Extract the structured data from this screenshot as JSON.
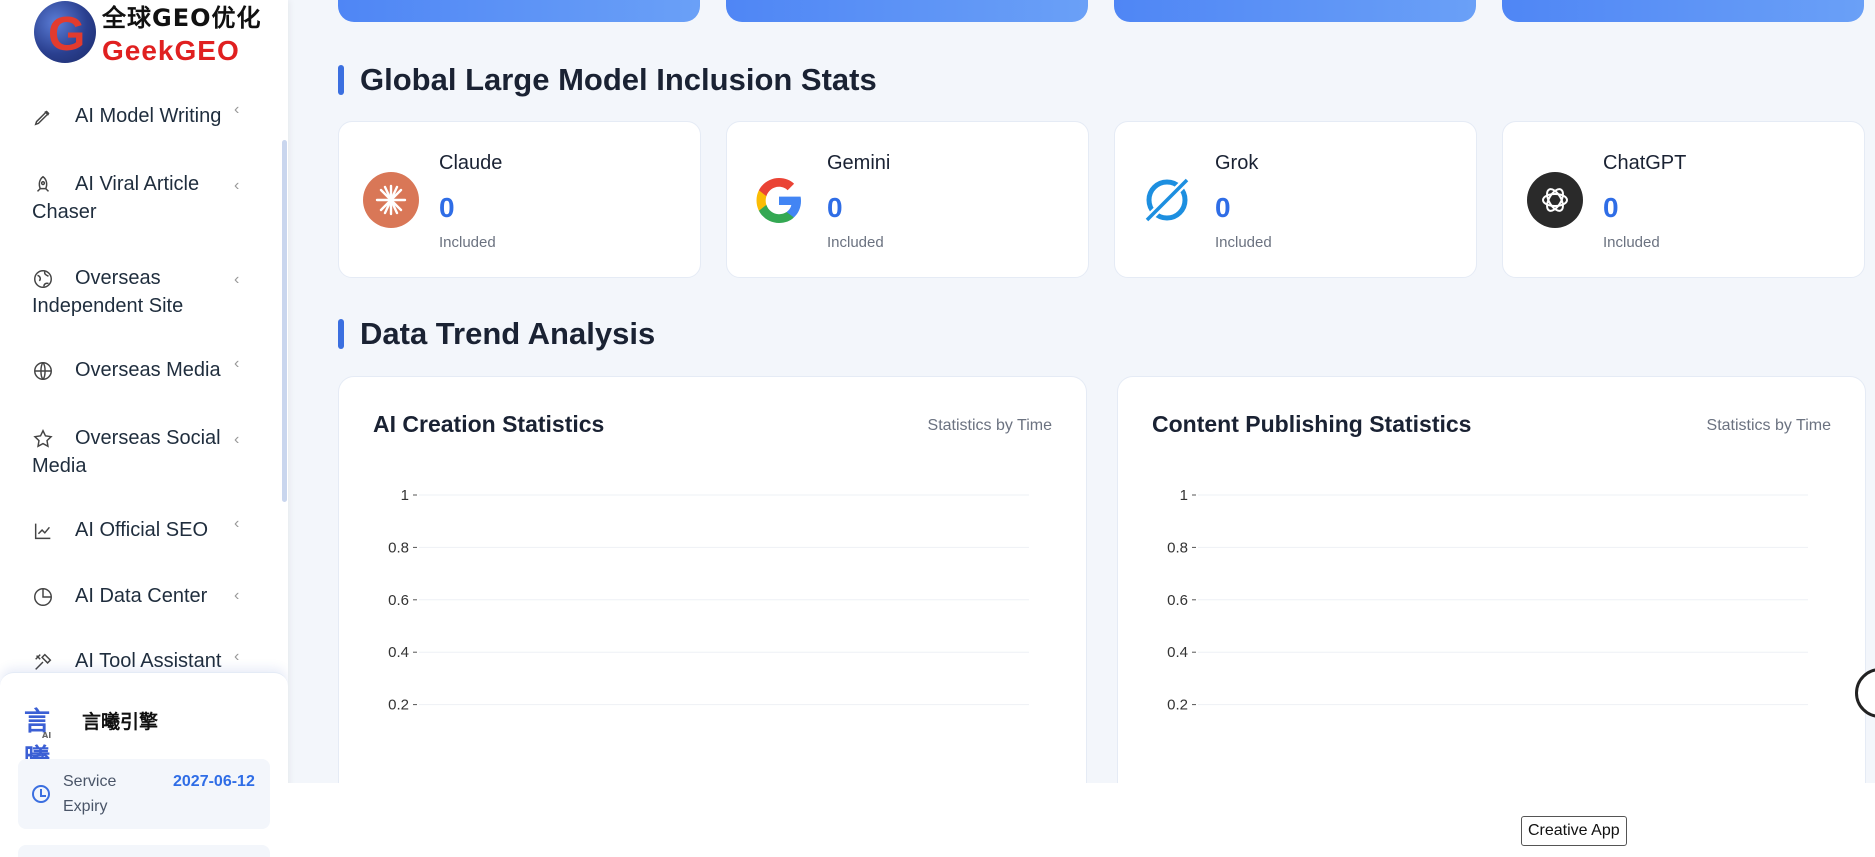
{
  "logo": {
    "cn": "全球GEO优化",
    "en": "GeekGEO"
  },
  "sidebar": {
    "items": [
      {
        "label": "AI Model Writing",
        "icon": "pen-icon"
      },
      {
        "label": "AI Viral Article Chaser",
        "icon": "rocket-icon"
      },
      {
        "label": "Overseas Independent Site",
        "icon": "globe-icon"
      },
      {
        "label": "Overseas Media",
        "icon": "world-icon"
      },
      {
        "label": "Overseas Social Media",
        "icon": "star-icon"
      },
      {
        "label": "AI Official SEO",
        "icon": "line-chart-icon"
      },
      {
        "label": "AI Data Center",
        "icon": "pie-chart-icon"
      },
      {
        "label": "AI Tool Assistant",
        "icon": "tools-icon"
      }
    ],
    "footer": {
      "brand_logo": "言曦",
      "brand_logo_sub": "AI",
      "brand_name": "言曦引擎",
      "expiry_label": "Service Expiry",
      "expiry_value": "2027-06-12"
    }
  },
  "sections": {
    "inclusion_title": "Global Large Model Inclusion Stats",
    "trend_title": "Data Trend Analysis"
  },
  "stats": [
    {
      "name": "Claude",
      "value": "0",
      "sub": "Included",
      "icon": "claude-icon",
      "color": "#d97757"
    },
    {
      "name": "Gemini",
      "value": "0",
      "sub": "Included",
      "icon": "google-icon",
      "color": "#4285f4"
    },
    {
      "name": "Grok",
      "value": "0",
      "sub": "Included",
      "icon": "grok-icon",
      "color": "#1d8fe0"
    },
    {
      "name": "ChatGPT",
      "value": "0",
      "sub": "Included",
      "icon": "openai-icon",
      "color": "#2a2a2a"
    }
  ],
  "charts": [
    {
      "title": "AI Creation Statistics",
      "subtitle": "Statistics by Time"
    },
    {
      "title": "Content Publishing Statistics",
      "subtitle": "Statistics by Time"
    }
  ],
  "chart_data": [
    {
      "type": "line",
      "title": "AI Creation Statistics",
      "subtitle": "Statistics by Time",
      "yticks": [
        "1",
        "0.8",
        "0.6",
        "0.4",
        "0.2"
      ],
      "ylim": [
        0,
        1
      ],
      "series": [],
      "grid": true
    },
    {
      "type": "line",
      "title": "Content Publishing Statistics",
      "subtitle": "Statistics by Time",
      "yticks": [
        "1",
        "0.8",
        "0.6",
        "0.4",
        "0.2"
      ],
      "ylim": [
        0,
        1
      ],
      "series": [],
      "grid": true
    }
  ],
  "bottom": {
    "creative_app_label": "Creative App"
  },
  "colors": {
    "accent": "#2f6de6",
    "brand_red": "#e02020"
  }
}
